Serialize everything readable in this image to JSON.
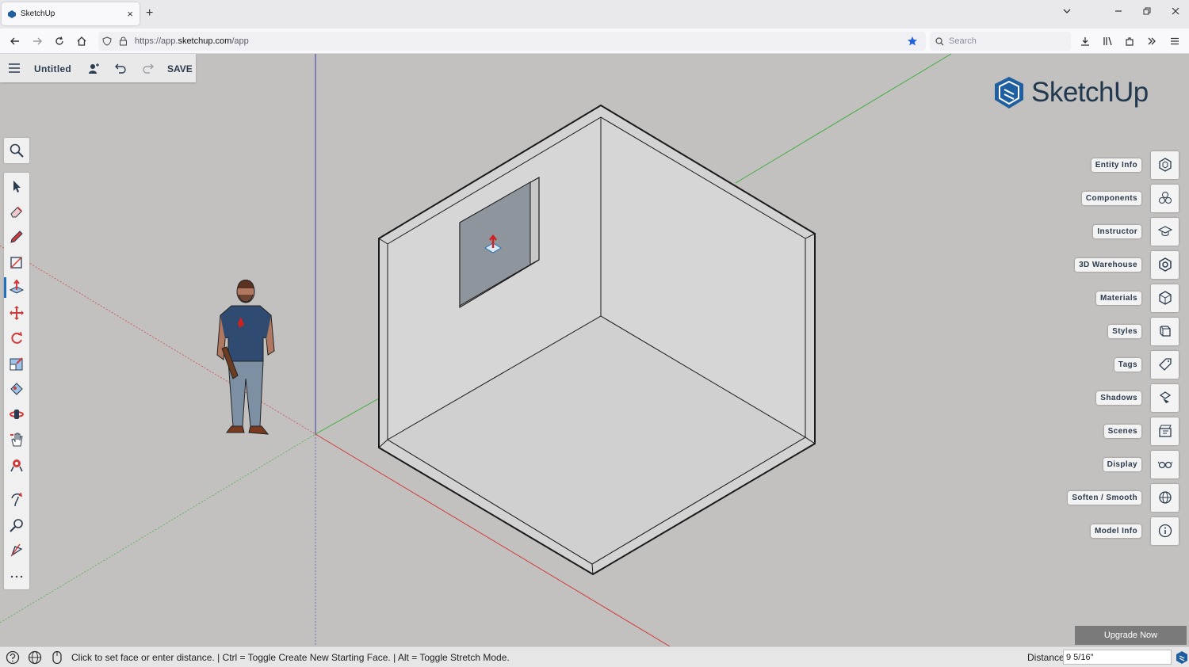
{
  "browser": {
    "tab_title": "SketchUp",
    "tab_close": "×",
    "new_tab": "+",
    "url_prefix": "https://app.",
    "url_domain": "sketchup.com",
    "url_path": "/app",
    "search_placeholder": "Search"
  },
  "app": {
    "doc_title": "Untitled",
    "save_label": "SAVE",
    "logo_text": "SketchUp"
  },
  "tools": [
    "magnify-icon",
    "select-icon",
    "eraser-icon",
    "pencil-icon",
    "shape-icon",
    "push-pull-icon",
    "move-icon",
    "rotate-icon",
    "scale-icon",
    "paint-bucket-icon",
    "orbit-icon",
    "pan-icon",
    "zoom-extents-icon",
    "walk-icon",
    "zoom-icon",
    "measure-icon",
    "more-icon"
  ],
  "panels": [
    {
      "label": "Entity Info",
      "icon": "entity-info-icon"
    },
    {
      "label": "Components",
      "icon": "components-icon"
    },
    {
      "label": "Instructor",
      "icon": "instructor-icon"
    },
    {
      "label": "3D Warehouse",
      "icon": "warehouse-icon"
    },
    {
      "label": "Materials",
      "icon": "materials-icon"
    },
    {
      "label": "Styles",
      "icon": "styles-icon"
    },
    {
      "label": "Tags",
      "icon": "tags-icon"
    },
    {
      "label": "Shadows",
      "icon": "shadows-icon"
    },
    {
      "label": "Scenes",
      "icon": "scenes-icon"
    },
    {
      "label": "Display",
      "icon": "display-icon"
    },
    {
      "label": "Soften / Smooth",
      "icon": "soften-icon"
    },
    {
      "label": "Model Info",
      "icon": "model-info-icon"
    }
  ],
  "upgrade_label": "Upgrade Now",
  "status": {
    "message": "Click to set face or enter distance. | Ctrl = Toggle Create New Starting Face. | Alt = Toggle Stretch Mode.",
    "distance_label": "Distance",
    "distance_value": "9 5/16\""
  },
  "colors": {
    "accent": "#1f6fbf",
    "logo": "#21384f",
    "axis_red": "#d03a3a",
    "axis_green": "#3fae3f",
    "axis_blue": "#3a3aa8",
    "background": "#c2c1bf"
  }
}
